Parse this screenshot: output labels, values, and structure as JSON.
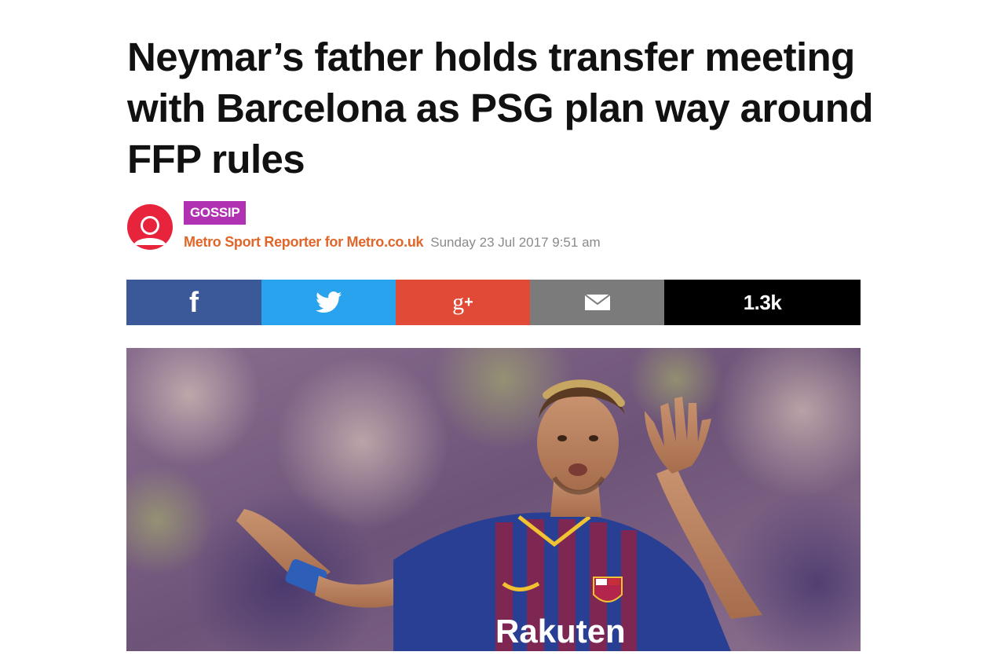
{
  "article": {
    "headline": "Neymar’s father holds transfer meeting with Barcelona as PSG plan way around FFP rules",
    "category": "GOSSIP",
    "author": "Metro Sport Reporter for Metro.co.uk",
    "date": "Sunday 23 Jul 2017 9:51 am"
  },
  "share": {
    "facebook_icon": "facebook-icon",
    "twitter_icon": "twitter-icon",
    "googleplus_icon": "google-plus-icon",
    "email_icon": "email-icon",
    "count": "1.3k"
  },
  "photo": {
    "shirt_sponsor": "Rakuten"
  },
  "colors": {
    "category_badge": "#b031b2",
    "author": "#e0662a",
    "facebook": "#3b5998",
    "twitter": "#2aa3ef",
    "googleplus": "#e04a36",
    "email": "#7b7b7b",
    "count_bg": "#000000"
  }
}
